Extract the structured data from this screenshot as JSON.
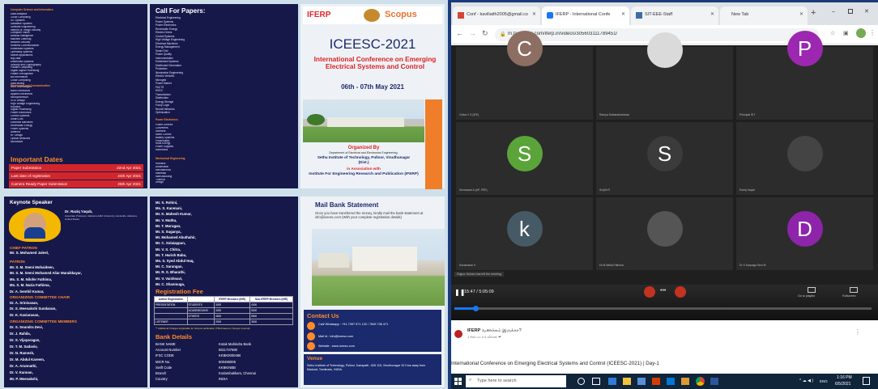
{
  "brochure": {
    "panel1": {
      "topics_header": "Computer Science and Informatics",
      "topics": [
        "Data Analytics",
        "Cloud Computing",
        "IoT Systems",
        "Database Systems",
        "Software Engineering",
        "Internet of Things Security",
        "Computer Vision",
        "Artificial Intelligence",
        "Machine Learning",
        "Network Security",
        "Wireless Communication",
        "Embedded Systems",
        "Operating Systems",
        "Mobile Applications",
        "Big Data",
        "Distributed Systems",
        "Security and Cryptography",
        "Parallel Computing",
        "Digital Signal Processing",
        "Pattern Recognition",
        "Bio Informatics",
        "Cloud Computing",
        "Data Mining",
        "Web Technologies"
      ],
      "topics2_header": "Electronics and Communication",
      "topics2": [
        "Nano Electronics",
        "Applied Electronics",
        "Microprocessor",
        "VLSI Design",
        "High Voltage Engineering",
        "Robotics",
        "Signal Processing",
        "Power Electronics",
        "Control Systems",
        "Smart Grid",
        "Electrical Machines",
        "Renewable Energy",
        "Power Systems",
        "Antenna",
        "RF Design",
        "Optical Networks",
        "Microwave"
      ],
      "important_dates_title": "Important Dates",
      "dates": [
        {
          "label": "Paper Submission",
          "value": "22nd Apr 2021"
        },
        {
          "label": "Last date of registration",
          "value": "24th Apr 2021"
        },
        {
          "label": "Camera Ready Paper Submission",
          "value": "25th Apr 2021"
        }
      ]
    },
    "panel2": {
      "title": "Call For Papers:",
      "tracks": [
        "Electrical Engineering",
        "Power Systems",
        "Power Electronics",
        "Renewable Energy",
        "Electric Drives",
        "Control Systems",
        "High Voltage Engineering",
        "Electrical Machines",
        "Energy Management",
        "Smart Grid",
        "Power Quality",
        "Instrumentation",
        "Embedded Systems",
        "Distributed Generation",
        "Protection",
        "Illumination Engineering",
        "Electric Vehicles",
        "Microgrid",
        "Power Market",
        "FACTS",
        "HVDC",
        "Transmission",
        "Distribution",
        "Energy Storage",
        "Fuzzy Logic",
        "Neural Networks",
        "Optimization"
      ],
      "track2_header": "Power Electronics",
      "tracks2": [
        "Power Devices",
        "Converters",
        "Inverters",
        "Motor Control",
        "Battery Systems",
        "Photovoltaic",
        "Wind Energy",
        "Power Supplies",
        "Harmonics"
      ],
      "track3_header": "Mechanical Engineering",
      "tracks3": [
        "Robotics",
        "Automation",
        "Mechatronics",
        "Materials",
        "Manufacturing",
        "Thermal",
        "Design"
      ]
    },
    "panel3": {
      "ifern_logo": "IFERP",
      "scopus_logo": "Scopus",
      "event_code": "ICEESC-2021",
      "event_name": "International Conference on Emerging Electrical Systems and Control",
      "event_dates": "06th - 07th May 2021",
      "organized_by_label": "Organized By",
      "organizer_dept": "Department of Electrical and Electronics Engineering,",
      "organizer_college": "Sethu Institute of Technology, Pulloor, Virudhunagar (Dist.)",
      "in_association": "in Association with",
      "partner": "Institute For Engineering Research and Publication (IFERP)"
    },
    "panel4": {
      "keynote_title": "Keynote Speaker",
      "speaker_name": "Dr. Raziq Yaqub,",
      "speaker_role": "Associate Professor, Alabama A&M University, Huntsville, Alabama, United States",
      "chief_patron_title": "CHIEF PATRON",
      "chief_patron": "Mr. S. Mohamed Jaleel,",
      "patron_title": "PATRON",
      "patrons": [
        "Mr. S. M. Seeni Mohaideen,",
        "Mr. S. M. Seeni Mohamed Aliar Maraikkayar,",
        "Ms. S. M. Nilofer Fathima,",
        "Ms. S. M. Nazia Fathima,",
        "Dr. A. Senthil Kumar,"
      ],
      "convener_title": "ORGANIZING COMMITTEE CHAIR",
      "conveners": [
        "Dr. A. Srinivasan,",
        "Dr. S. Meenakshi Sundaram,",
        "Dr. K. Kaviarasan,"
      ],
      "members_title": "ORGANIZING COMMITTEE MEMBERS",
      "members": [
        "Dr. S. Soundra Devi,",
        "Dr. J. Rahila,",
        "Dr. S. Vijayaragan,",
        "Dr. T. M. Sadasiv,",
        "Dr. N. Ramesh,",
        "Dr. M. Abdul Kareem,",
        "Dr. A. Arunnathi,",
        "Dr. V. Kannan,",
        "Mr. P. Meenakshi,"
      ]
    },
    "panel5": {
      "members": [
        "Mr. S. Rohini,",
        "Ms. S. Kanmani,",
        "Mr. K. Mahesh Kumar,",
        "Mr. V. Muthu,",
        "Mr. T. Murugan,",
        "Mr. S. Suganya,",
        "Mr. Mohamed Abuthahir,",
        "Mr. C. Solaiappan,",
        "Mr. V. S. Chitra,",
        "Mr. T. Harish Babu,",
        "Ms. S. Syed Abdul Haq,",
        "Mr. C. Sarangan,",
        "Mr. R. S. Bharathi,",
        "Mr. V. Vaishnavi,",
        "Mr. C. Shanmuga,"
      ],
      "registration_title": "Registration Fee",
      "fee_headers": [
        "Author Registration",
        "",
        "IFERP Members (INR)",
        "Non-IFERP Members (INR)"
      ],
      "fee_rows": [
        {
          "cat": "PRESENTATION",
          "sub": "STUDENTS",
          "a": "3000",
          "b": "4000"
        },
        {
          "cat": "",
          "sub": "ACADEMICIANS",
          "a": "4000",
          "b": "5000"
        },
        {
          "cat": "",
          "sub": "OTHERS",
          "a": "4500",
          "b": "5500"
        },
        {
          "cat": "LISTENER",
          "sub": "",
          "a": "2000",
          "b": "3000"
        }
      ],
      "fee_note": "** Additional Charges Applicable for Scopus publication (TBA based on Scopus Journal)",
      "bank_title": "Bank Details",
      "bank_rows": [
        {
          "k": "BANK NAME",
          "v": "Kotak Mahindra Bank"
        },
        {
          "k": "Account Number",
          "v": "5611747580"
        },
        {
          "k": "IFSC CODE",
          "v": "KKBK0000466"
        },
        {
          "k": "MICR No.",
          "v": "600485006"
        },
        {
          "k": "Swift Code",
          "v": "KKBKINBB"
        },
        {
          "k": "Branch",
          "v": "Kodambakkam, Chennai"
        },
        {
          "k": "Country",
          "v": "INDIA"
        }
      ]
    },
    "panel6": {
      "mail_title": "Mail Bank Statement",
      "mail_text": "Once you have transferred the money, kindly mail the bank statement at info@iceesc.com (With your complete registration details)",
      "contact_title": "Contact Us",
      "contact_call": "Call/ Whatsapp : +91-7397 571 132 / 7845 736 471",
      "contact_mail": "Mail Id : info@iceesc.com",
      "contact_web": "Website : www.iceesc.com",
      "venue_title": "Venue",
      "venue_text": "Sethu Institute of Technology, Pulloor, Kariapatti - 626 115, Virudhunagar 32 Kms away from Madurai, Tamilnadu, INDIA."
    }
  },
  "browser": {
    "tabs": [
      {
        "title": "Conf - kaviliaith2005@gmail.co"
      },
      {
        "title": "IFERP - International Confe"
      },
      {
        "title": "SIT-EEE-Staff"
      },
      {
        "title": "New Tab"
      }
    ],
    "new_tab": "+",
    "url": "m.facebook.com/iferp.in/videos/305603111789451/",
    "tab_icon_colors": [
      "#d44638",
      "#1877f2",
      "#3b6ea5",
      "#888888"
    ]
  },
  "video": {
    "participants": [
      {
        "initial": "C",
        "name": "Chitra V S (IEE)",
        "color": "#8d6e63"
      },
      {
        "initial": "",
        "name": "Ramya Sathanakrishnan",
        "color": "#dadada"
      },
      {
        "initial": "P",
        "name": "Principal SIT",
        "color": "#9c27b0"
      },
      {
        "initial": "S",
        "name": "Srinivasan A (AP, PEE)",
        "color": "#5aa43a"
      },
      {
        "initial": "S",
        "name": "Surjith R",
        "color": "#3b3b3b"
      },
      {
        "initial": "",
        "name": "Raziq Yaqub",
        "color": "#444444"
      },
      {
        "initial": "k",
        "name": "Kaviarasan K",
        "color": "#455a64"
      },
      {
        "initial": "",
        "name": "Dr.M.Nellai Fathima",
        "color": "#555555"
      },
      {
        "initial": "D",
        "name": "Dr G Karpaga Devi M",
        "color": "#8e24aa"
      }
    ],
    "left_message": "Rajpur Mohan has left the meeting",
    "time": "15:47 / 5:05:09",
    "progress_fraction": 0.05,
    "go_to_playlist": "Go to playlist",
    "fullscreen": "Fullscreen"
  },
  "page": {
    "channel_name": "IFERP",
    "channel_sub": "வணக்கம் இருக்கா?",
    "channel_meta": "1 Rss  செ 4.3 வின்ஸ்  ❤",
    "video_title": "International Conference on Emerging Electrical Systems and Control (ICEESC-2021) | Day-1"
  },
  "taskbar": {
    "search_placeholder": "Type here to search",
    "time": "1:16 PM",
    "date": "6/5/2021",
    "lang": "ENG"
  }
}
